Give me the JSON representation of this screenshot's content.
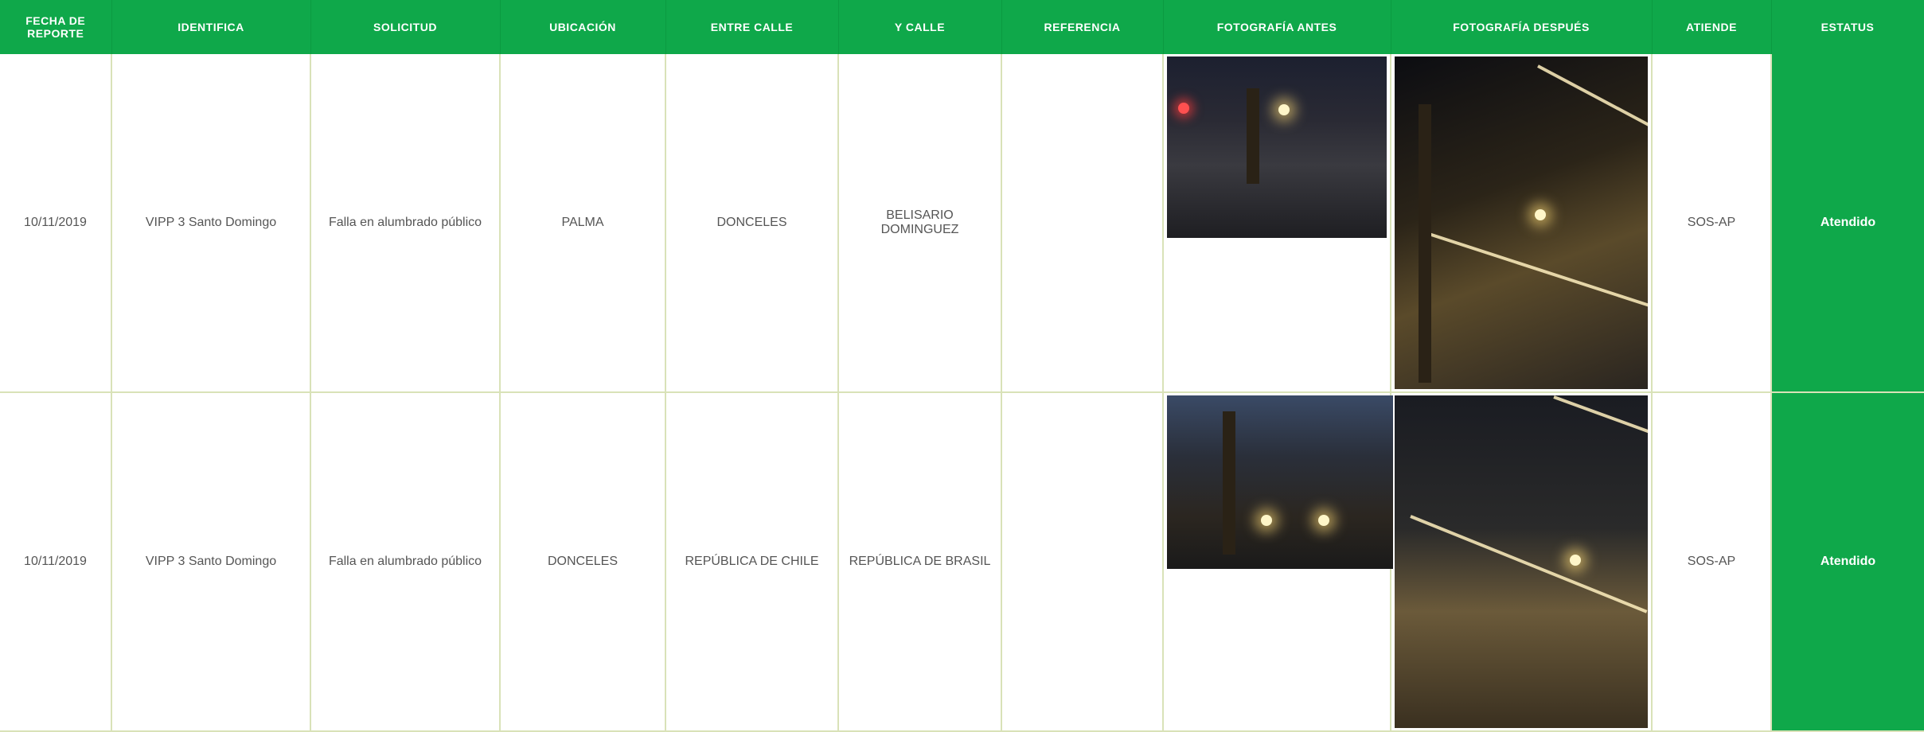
{
  "headers": {
    "fecha": "FECHA DE REPORTE",
    "identifica": "IDENTIFICA",
    "solicitud": "SOLICITUD",
    "ubicacion": "UBICACIÓN",
    "entre_calle": "ENTRE CALLE",
    "y_calle": "Y CALLE",
    "referencia": "REFERENCIA",
    "foto_antes": "FOTOGRAFÍA ANTES",
    "foto_despues": "FOTOGRAFÍA DESPUÉS",
    "atiende": "ATIENDE",
    "estatus": "ESTATUS"
  },
  "rows": [
    {
      "fecha": "10/11/2019",
      "identifica": "VIPP 3 Santo Domingo",
      "solicitud": "Falla en alumbrado público",
      "ubicacion": "PALMA",
      "entre_calle": "DONCELES",
      "y_calle": "BELISARIO DOMINGUEZ",
      "referencia": "",
      "atiende": "SOS-AP",
      "estatus": "Atendido"
    },
    {
      "fecha": "10/11/2019",
      "identifica": "VIPP 3 Santo Domingo",
      "solicitud": "Falla en alumbrado público",
      "ubicacion": "DONCELES",
      "entre_calle": "REPÚBLICA DE CHILE",
      "y_calle": "REPÚBLICA DE BRASIL",
      "referencia": "",
      "atiende": "SOS-AP",
      "estatus": "Atendido"
    }
  ],
  "colors": {
    "header_bg": "#0fa84a",
    "border": "#d9e2b8",
    "text": "#555555"
  }
}
